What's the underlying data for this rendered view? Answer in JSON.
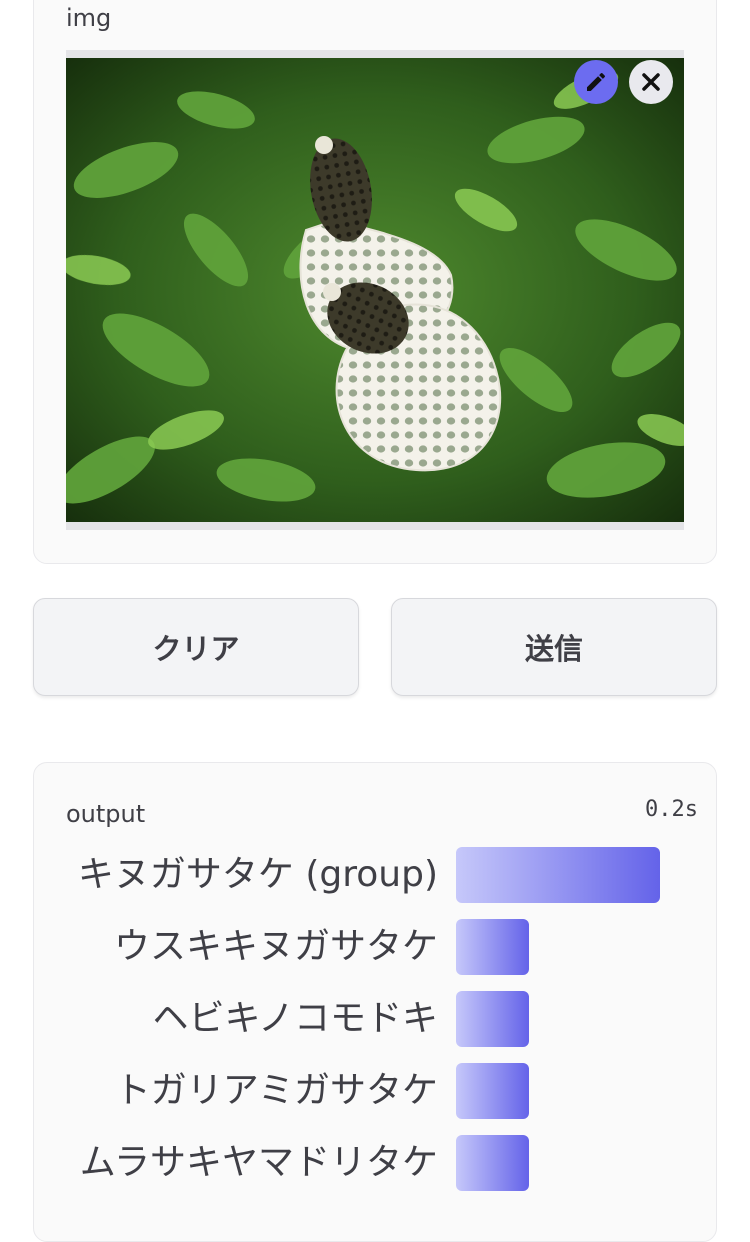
{
  "input": {
    "label": "img",
    "image_alt": "two net-veiled mushrooms among green leaves",
    "edit_icon": "pencil-icon",
    "close_icon": "close-icon"
  },
  "buttons": {
    "clear_label": "クリア",
    "submit_label": "送信"
  },
  "output": {
    "label": "output",
    "timing": "0.2s",
    "results": [
      {
        "label": "キヌガサタケ (group)",
        "confidence": 1.0
      },
      {
        "label": "ウスキキヌガサタケ",
        "confidence": 0.36
      },
      {
        "label": "ヘビキノコモドキ",
        "confidence": 0.36
      },
      {
        "label": "トガリアミガサタケ",
        "confidence": 0.36
      },
      {
        "label": "ムラサキヤマドリタケ",
        "confidence": 0.36
      }
    ]
  },
  "colors": {
    "accent": "#6463e9",
    "bar_start": "#c6c8fa"
  }
}
